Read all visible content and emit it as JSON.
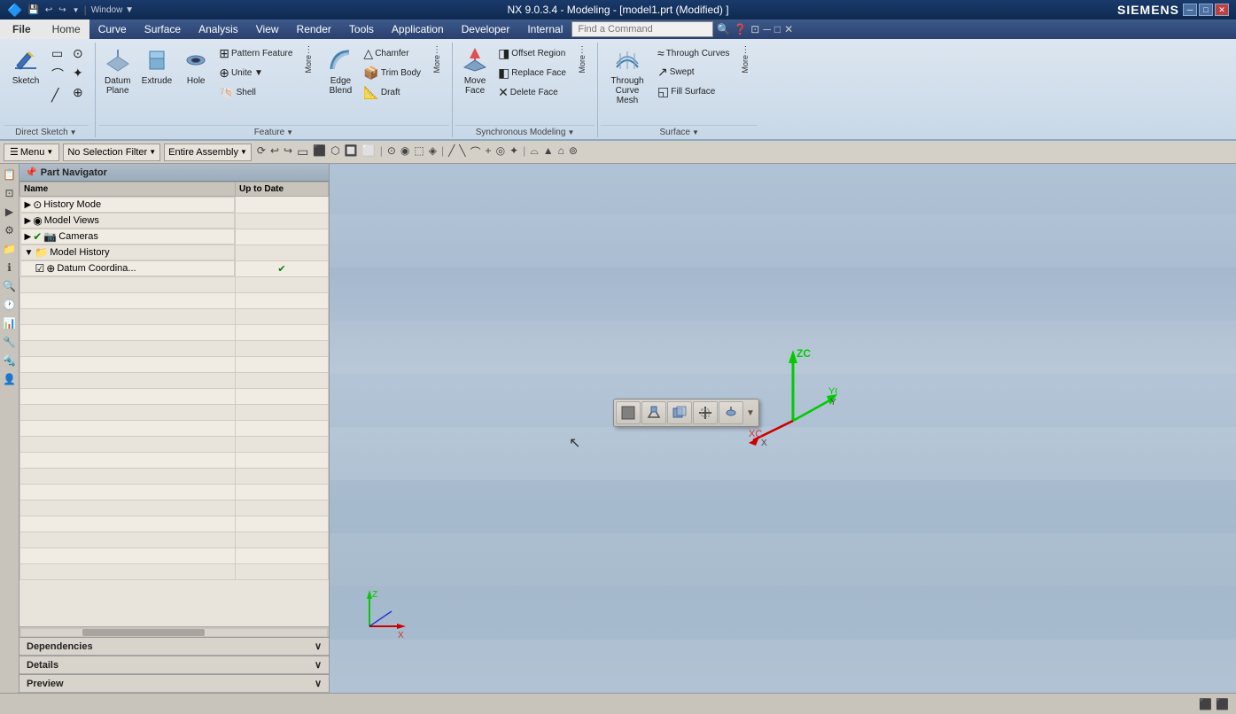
{
  "titlebar": {
    "title": "NX 9.0.3.4 - Modeling - [model1.prt (Modified) ]",
    "logo": "SIEMENS",
    "minimize": "─",
    "maximize": "□",
    "close": "✕"
  },
  "quickaccess": {
    "icons": [
      "💾",
      "↩",
      "↪",
      "📋",
      "✂",
      "📄"
    ]
  },
  "menubar": {
    "items": [
      "File",
      "Home",
      "Curve",
      "Surface",
      "Analysis",
      "View",
      "Render",
      "Tools",
      "Application",
      "Developer",
      "Internal"
    ],
    "active": "Home",
    "find_placeholder": "Find a Command"
  },
  "ribbon": {
    "groups": [
      {
        "label": "Direct Sketch",
        "buttons": [
          {
            "icon": "✏",
            "label": "Sketch"
          },
          {
            "icon": "⬚",
            "label": ""
          },
          {
            "icon": "⌒",
            "label": ""
          },
          {
            "icon": "╲",
            "label": ""
          },
          {
            "icon": "⊕",
            "label": ""
          },
          {
            "icon": "⊙",
            "label": ""
          },
          {
            "icon": "⊕",
            "label": ""
          },
          {
            "icon": "▼",
            "label": ""
          }
        ]
      },
      {
        "label": "Feature",
        "buttons": [
          {
            "icon": "◈",
            "label": "Datum Plane"
          },
          {
            "icon": "⬜",
            "label": "Extrude"
          },
          {
            "icon": "⭕",
            "label": "Hole"
          },
          {
            "small": true,
            "icon": "⊞",
            "label": "Pattern Feature"
          },
          {
            "small": true,
            "icon": "➕",
            "label": "Unite"
          },
          {
            "small": true,
            "icon": "🐚",
            "label": "Shell"
          },
          {
            "more": true,
            "label": "More"
          },
          {
            "icon": "🔗",
            "label": "Edge Blend"
          },
          {
            "small": true,
            "icon": "△",
            "label": "Chamfer"
          },
          {
            "small": true,
            "icon": "📦",
            "label": "Trim Body"
          },
          {
            "small": true,
            "icon": "📐",
            "label": "Draft"
          },
          {
            "more": true,
            "label": "More"
          }
        ]
      },
      {
        "label": "Synchronous Modeling",
        "buttons": [
          {
            "icon": "⟳",
            "label": "Move Face"
          },
          {
            "small": true,
            "icon": "◨",
            "label": "Offset Region"
          },
          {
            "small": true,
            "icon": "◧",
            "label": "Replace Face"
          },
          {
            "small": true,
            "icon": "✕",
            "label": "Delete Face"
          },
          {
            "more": true,
            "label": "More"
          }
        ]
      },
      {
        "label": "Surface",
        "buttons": [
          {
            "icon": "〰",
            "label": "Through Curve Mesh"
          },
          {
            "small": true,
            "icon": "≈",
            "label": "Through Curves"
          },
          {
            "small": true,
            "icon": "↗",
            "label": "Swept"
          },
          {
            "small": true,
            "icon": "◱",
            "label": "Fill Surface"
          },
          {
            "more": true,
            "label": "More"
          }
        ]
      }
    ]
  },
  "selectionbar": {
    "menu_label": "Menu",
    "filter_label": "No Selection Filter",
    "assembly_label": "Entire Assembly",
    "icons": [
      "⟳",
      "↩",
      "↪",
      "⬚",
      "⬛",
      "⬡",
      "🔲",
      "⬜",
      "⬛",
      "◉",
      "⊡",
      "🔳",
      "◈",
      "△",
      "⌓",
      "+",
      "╲",
      "⌒",
      "⊙"
    ]
  },
  "navigator": {
    "title": "Part Navigator",
    "columns": [
      "Name",
      "Up to Date"
    ],
    "tree": [
      {
        "depth": 0,
        "expand": "▶",
        "icon": "⊙",
        "name": "History Mode",
        "status": ""
      },
      {
        "depth": 0,
        "expand": "▶",
        "icon": "◉",
        "name": "Model Views",
        "status": ""
      },
      {
        "depth": 0,
        "expand": "▶",
        "icon": "📷",
        "name": "Cameras",
        "status": ""
      },
      {
        "depth": 0,
        "expand": "▼",
        "icon": "📁",
        "name": "Model History",
        "status": ""
      },
      {
        "depth": 1,
        "expand": "",
        "icon": "☑",
        "name": "Datum Coordina...",
        "status": "✔"
      }
    ]
  },
  "nav_bottom": {
    "dependencies": "Dependencies",
    "details": "Details",
    "preview": "Preview",
    "collapse": "∨"
  },
  "floating_toolbar": {
    "buttons": [
      "⬜",
      "📦",
      "🔲",
      "↔",
      "▼"
    ]
  },
  "coordinate": {
    "xc": "XC",
    "yc": "YC",
    "zc": "ZC",
    "x": "X",
    "y": "Y",
    "z": "Z"
  },
  "coord_small": {
    "x": "X",
    "z": "Z"
  },
  "statusbar": {
    "text": "",
    "icons": [
      "⬛",
      "⬛"
    ]
  }
}
